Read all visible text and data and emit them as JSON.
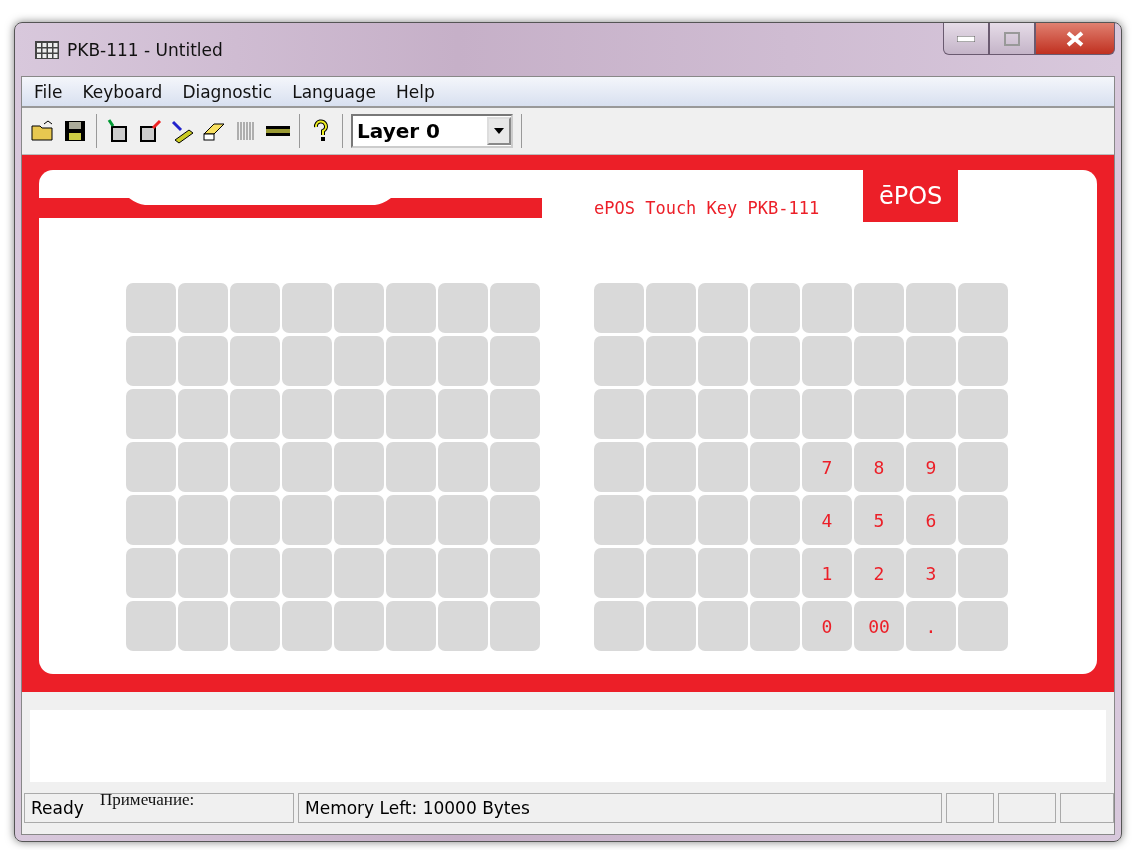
{
  "window": {
    "title": "PKB-111 - Untitled"
  },
  "menu": [
    "File",
    "Keyboard",
    "Diagnostic",
    "Language",
    "Help"
  ],
  "toolbar": {
    "layer": "Layer 0"
  },
  "keyboard": {
    "title": "ePOS Touch Key PKB-111",
    "logo": "ēPOS",
    "left_grid": [
      [
        {
          "kind": "blank"
        },
        {
          "kind": "blank"
        },
        {
          "kind": "blank"
        },
        {
          "kind": "blank"
        },
        {
          "kind": "blank"
        },
        {
          "kind": "blank"
        },
        {
          "kind": "blank"
        },
        {
          "kind": "blank"
        }
      ],
      [
        {
          "kind": "blank"
        },
        {
          "kind": "blank"
        },
        {
          "kind": "blank"
        },
        {
          "kind": "blank"
        },
        {
          "kind": "blank"
        },
        {
          "kind": "blank"
        },
        {
          "kind": "blank"
        },
        {
          "kind": "blank"
        }
      ],
      [
        {
          "kind": "blank"
        },
        {
          "kind": "blank"
        },
        {
          "kind": "blank"
        },
        {
          "kind": "blank"
        },
        {
          "kind": "blank"
        },
        {
          "kind": "blank"
        },
        {
          "kind": "blank"
        },
        {
          "kind": "blank"
        }
      ],
      [
        {
          "kind": "blank"
        },
        {
          "kind": "blank"
        },
        {
          "kind": "blank"
        },
        {
          "kind": "blank"
        },
        {
          "kind": "blank"
        },
        {
          "kind": "blank"
        },
        {
          "kind": "blank"
        },
        {
          "kind": "blank"
        }
      ],
      [
        {
          "kind": "blank"
        },
        {
          "kind": "blank"
        },
        {
          "kind": "blank"
        },
        {
          "kind": "blank"
        },
        {
          "kind": "blank"
        },
        {
          "kind": "blank"
        },
        {
          "kind": "blank"
        },
        {
          "kind": "blank"
        }
      ],
      [
        {
          "kind": "blank"
        },
        {
          "kind": "blank"
        },
        {
          "kind": "blank"
        },
        {
          "kind": "blank"
        },
        {
          "kind": "blank"
        },
        {
          "kind": "blank"
        },
        {
          "kind": "blank"
        },
        {
          "kind": "blank"
        }
      ],
      [
        {
          "kind": "blank"
        },
        {
          "kind": "blank"
        },
        {
          "kind": "blank"
        },
        {
          "kind": "blank"
        },
        {
          "kind": "blank"
        },
        {
          "kind": "blank"
        },
        {
          "kind": "blank"
        },
        {
          "kind": "blank"
        }
      ]
    ],
    "right_grid": [
      [
        {
          "kind": "blank"
        },
        {
          "kind": "blank"
        },
        {
          "kind": "blank"
        },
        {
          "kind": "blank"
        },
        {
          "kind": "blank"
        },
        {
          "kind": "blank"
        },
        {
          "kind": "blank"
        },
        {
          "kind": "blank"
        }
      ],
      [
        {
          "kind": "blank"
        },
        {
          "kind": "blank"
        },
        {
          "kind": "blank"
        },
        {
          "kind": "blank"
        },
        {
          "kind": "blank"
        },
        {
          "kind": "blank"
        },
        {
          "kind": "blank"
        },
        {
          "kind": "blank"
        }
      ],
      [
        {
          "kind": "blank"
        },
        {
          "kind": "blank"
        },
        {
          "kind": "blank"
        },
        {
          "kind": "blank"
        },
        {
          "kind": "blank"
        },
        {
          "kind": "blank"
        },
        {
          "kind": "blank"
        },
        {
          "kind": "blank"
        }
      ],
      [
        {
          "kind": "blank"
        },
        {
          "kind": "blank"
        },
        {
          "kind": "blank"
        },
        {
          "kind": "blank"
        },
        {
          "kind": "label",
          "label": "7"
        },
        {
          "kind": "label",
          "label": "8"
        },
        {
          "kind": "label",
          "label": "9"
        },
        {
          "kind": "blank"
        }
      ],
      [
        {
          "kind": "blank"
        },
        {
          "kind": "blank"
        },
        {
          "kind": "blank"
        },
        {
          "kind": "blank"
        },
        {
          "kind": "label",
          "label": "4"
        },
        {
          "kind": "label",
          "label": "5"
        },
        {
          "kind": "label",
          "label": "6"
        },
        {
          "kind": "blank"
        }
      ],
      [
        {
          "kind": "blank"
        },
        {
          "kind": "blank"
        },
        {
          "kind": "blank"
        },
        {
          "kind": "blank"
        },
        {
          "kind": "label",
          "label": "1"
        },
        {
          "kind": "label",
          "label": "2"
        },
        {
          "kind": "label",
          "label": "3"
        },
        {
          "kind": "blank"
        }
      ],
      [
        {
          "kind": "blank"
        },
        {
          "kind": "blank"
        },
        {
          "kind": "blank"
        },
        {
          "kind": "blank"
        },
        {
          "kind": "label",
          "label": "0"
        },
        {
          "kind": "label",
          "label": "00"
        },
        {
          "kind": "label",
          "label": "."
        },
        {
          "kind": "blank"
        }
      ]
    ]
  },
  "note": {
    "label": "Примечание:"
  },
  "status_bar": {
    "state": "Ready",
    "memory": "Memory Left:  10000 Bytes"
  }
}
